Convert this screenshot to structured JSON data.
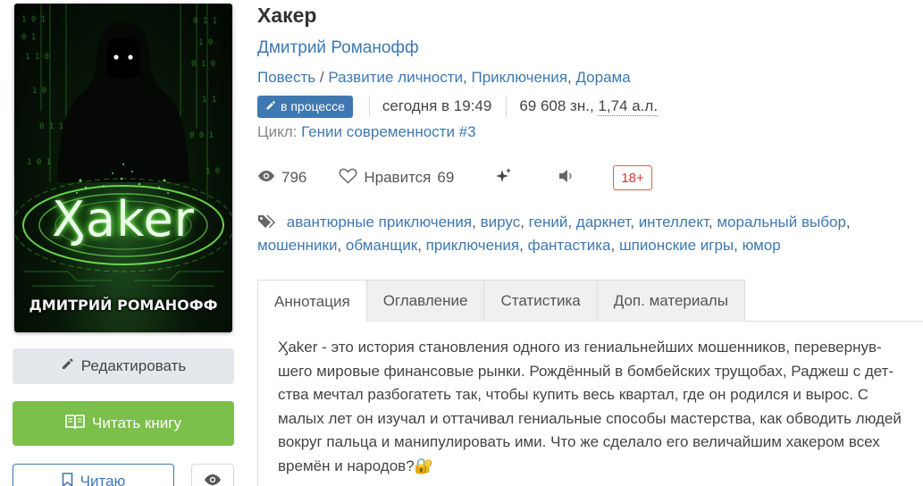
{
  "cover": {
    "title": "Ӽaker",
    "author": "ДМИТРИЙ РОМАНОФФ"
  },
  "buttons": {
    "edit": "Редактировать",
    "read": "Читать книгу",
    "reading": "Читаю"
  },
  "book": {
    "title": "Хакер",
    "author": "Дмитрий Романофф",
    "form": "Повесть",
    "separator": "/",
    "genres": [
      "Развитие личности",
      "Приключения",
      "Дорама"
    ],
    "status": "в процессе",
    "updated": "сегодня в 19:49",
    "size_chars": "69 608 зн.,",
    "size_sheets": "1,74 а.л.",
    "cycle_label": "Цикл:",
    "cycle": "Гении современности #3"
  },
  "stats": {
    "views": "796",
    "likes_label": "Нравится",
    "likes": "69",
    "age_rating": "18+"
  },
  "tags": [
    "авантюрные приключения",
    "вирус",
    "гений",
    "даркнет",
    "интеллект",
    "моральный выбор",
    "мошенники",
    "обманщик",
    "приключения",
    "фантастика",
    "шпионские игры",
    "юмор"
  ],
  "tabs": [
    "Аннотация",
    "Оглавление",
    "Статистика",
    "Доп. материалы"
  ],
  "annotation": "Ӽaker - это история становления одного из гениальнейших мошенников, перевернув­шего мировые финансовые рынки. Рождённый в бомбейских трущобах, Раджеш с дет­ства мечтал разбогатеть так, чтобы купить весь квартал, где он родился и вырос. С малых лет он изучал и оттачивал гениальные способы мастерства, как обводить лю­дей вокруг пальца и манипулировать ими. Что же сделало его величайшим хакером всех времён и народов?🔐",
  "icons": {
    "edit": "pencil-icon",
    "read": "book-open-icon",
    "reading": "bookmark-icon",
    "watch": "eye-icon",
    "views": "eye-icon",
    "likes": "heart-icon",
    "sparkle": "sparkles-icon",
    "audio": "speaker-icon",
    "tags": "tags-icon"
  },
  "colors": {
    "link": "#3f78b0",
    "badge": "#3f78b0",
    "read_button": "#7cbf4a",
    "age_rating": "#d33333"
  }
}
